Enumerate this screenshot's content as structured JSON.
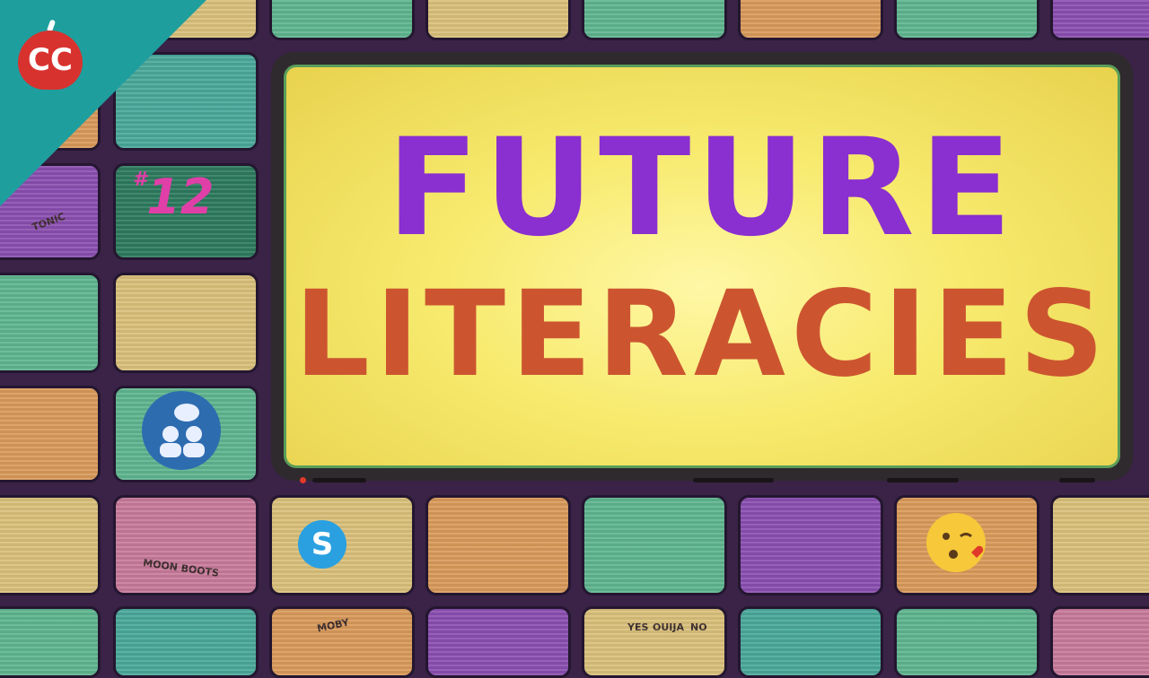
{
  "title": {
    "line1": "FUTURE",
    "line2": "LITERACIES"
  },
  "episode": {
    "hash": "#",
    "number": "12"
  },
  "logo": {
    "text": "CC",
    "name": "crash-course-logo"
  },
  "tile_labels": {
    "tonic": "TONIC",
    "moon_boots": "MOON BOOTS",
    "moby": "MOBY",
    "ouija_yes": "YES",
    "ouija_word": "OUIJA",
    "ouija_no": "NO",
    "skype": "S"
  },
  "colors": {
    "title_purple": "#8a2fd0",
    "title_orange": "#cc5530",
    "screen_yellow": "#f7ea6d",
    "episode_pink": "#e03fa8",
    "background": "#3a2346"
  }
}
